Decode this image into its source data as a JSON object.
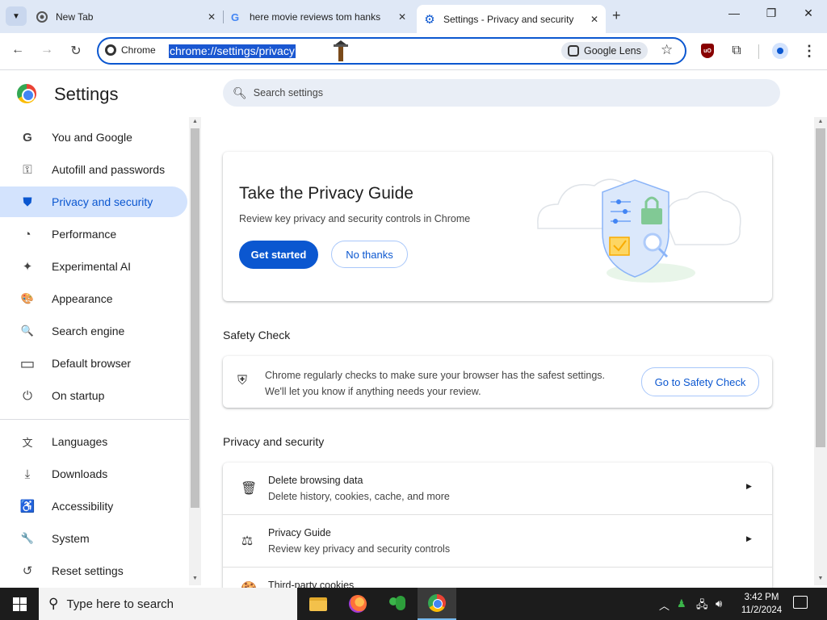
{
  "browser": {
    "tabs": [
      {
        "title": "New Tab",
        "icon": "chrome-icon",
        "active": false
      },
      {
        "title": "here movie reviews tom hanks",
        "icon": "google-icon",
        "active": false
      },
      {
        "title": "Settings - Privacy and security",
        "icon": "settings-gear-icon",
        "active": true
      }
    ],
    "new_tab_label": "+",
    "window_controls": {
      "minimize": "—",
      "maximize": "❐",
      "close": "✕"
    },
    "omnibox": {
      "chip_label": "Chrome",
      "url": "chrome://settings/privacy",
      "lens_label": "Google Lens"
    }
  },
  "settings": {
    "title": "Settings",
    "search_placeholder": "Search settings",
    "nav": [
      {
        "label": "You and Google",
        "icon": "G"
      },
      {
        "label": "Autofill and passwords",
        "icon": "⚿"
      },
      {
        "label": "Privacy and security",
        "icon": "⛊",
        "active": true
      },
      {
        "label": "Performance",
        "icon": "◔"
      },
      {
        "label": "Experimental AI",
        "icon": "✦"
      },
      {
        "label": "Appearance",
        "icon": "🎨"
      },
      {
        "label": "Search engine",
        "icon": "🔍"
      },
      {
        "label": "Default browser",
        "icon": "▭"
      },
      {
        "label": "On startup",
        "icon": "⏻"
      },
      {
        "label": "Languages",
        "icon": "文"
      },
      {
        "label": "Downloads",
        "icon": "⤓"
      },
      {
        "label": "Accessibility",
        "icon": "♿"
      },
      {
        "label": "System",
        "icon": "🔧"
      },
      {
        "label": "Reset settings",
        "icon": "↺"
      }
    ],
    "privacy_guide": {
      "title": "Take the Privacy Guide",
      "description": "Review key privacy and security controls in Chrome",
      "primary_button": "Get started",
      "secondary_button": "No thanks"
    },
    "safety_check": {
      "section_title": "Safety Check",
      "line1": "Chrome regularly checks to make sure your browser has the safest settings.",
      "line2": "We'll let you know if anything needs your review.",
      "button": "Go to Safety Check"
    },
    "privacy_section": {
      "section_title": "Privacy and security",
      "rows": [
        {
          "title": "Delete browsing data",
          "subtitle": "Delete history, cookies, cache, and more",
          "icon": "🗑"
        },
        {
          "title": "Privacy Guide",
          "subtitle": "Review key privacy and security controls",
          "icon": "⚖"
        },
        {
          "title": "Third-party cookies",
          "subtitle": "",
          "icon": "🍪"
        }
      ]
    }
  },
  "taskbar": {
    "search_placeholder": "Type here to search",
    "time": "3:42 PM",
    "date": "11/2/2024"
  },
  "colors": {
    "accent": "#0b57d0",
    "nav_active_bg": "#d3e3fd",
    "tabbar_bg": "#dfe8f6"
  }
}
